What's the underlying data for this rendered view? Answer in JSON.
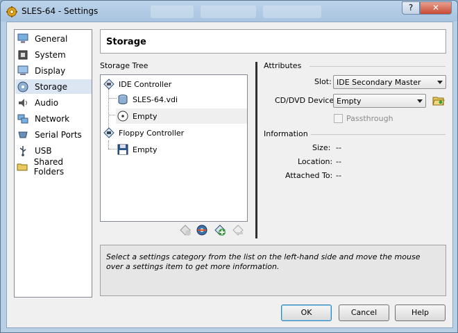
{
  "window": {
    "title": "SLES-64 - Settings",
    "help_label": "?",
    "close_label": "✕"
  },
  "sidebar": {
    "items": [
      {
        "label": "General",
        "icon": "monitor-icon"
      },
      {
        "label": "System",
        "icon": "chip-icon"
      },
      {
        "label": "Display",
        "icon": "display-icon"
      },
      {
        "label": "Storage",
        "icon": "disk-icon",
        "selected": true
      },
      {
        "label": "Audio",
        "icon": "speaker-icon"
      },
      {
        "label": "Network",
        "icon": "network-icon"
      },
      {
        "label": "Serial Ports",
        "icon": "serial-port-icon"
      },
      {
        "label": "USB",
        "icon": "usb-icon"
      },
      {
        "label": "Shared Folders",
        "icon": "folder-icon"
      }
    ]
  },
  "page": {
    "title": "Storage"
  },
  "storage_tree": {
    "label": "Storage Tree",
    "controllers": [
      {
        "label": "IDE Controller",
        "children": [
          {
            "label": "SLES-64.vdi"
          },
          {
            "label": "Empty",
            "selected": true
          }
        ]
      },
      {
        "label": "Floppy Controller",
        "children": [
          {
            "label": "Empty"
          }
        ]
      }
    ]
  },
  "attributes": {
    "heading": "Attributes",
    "slot_label": "Slot:",
    "slot_value": "IDE Secondary Master",
    "device_label": "CD/DVD Device:",
    "device_value": "Empty",
    "passthrough_label": "Passthrough"
  },
  "information": {
    "heading": "Information",
    "size_label": "Size:",
    "size_value": "--",
    "location_label": "Location:",
    "location_value": "--",
    "attached_label": "Attached To:",
    "attached_value": "--"
  },
  "help_text": "Select a settings category from the list on the left-hand side and move the mouse over a settings item to get more information.",
  "buttons": {
    "ok": "OK",
    "cancel": "Cancel",
    "help": "Help"
  }
}
